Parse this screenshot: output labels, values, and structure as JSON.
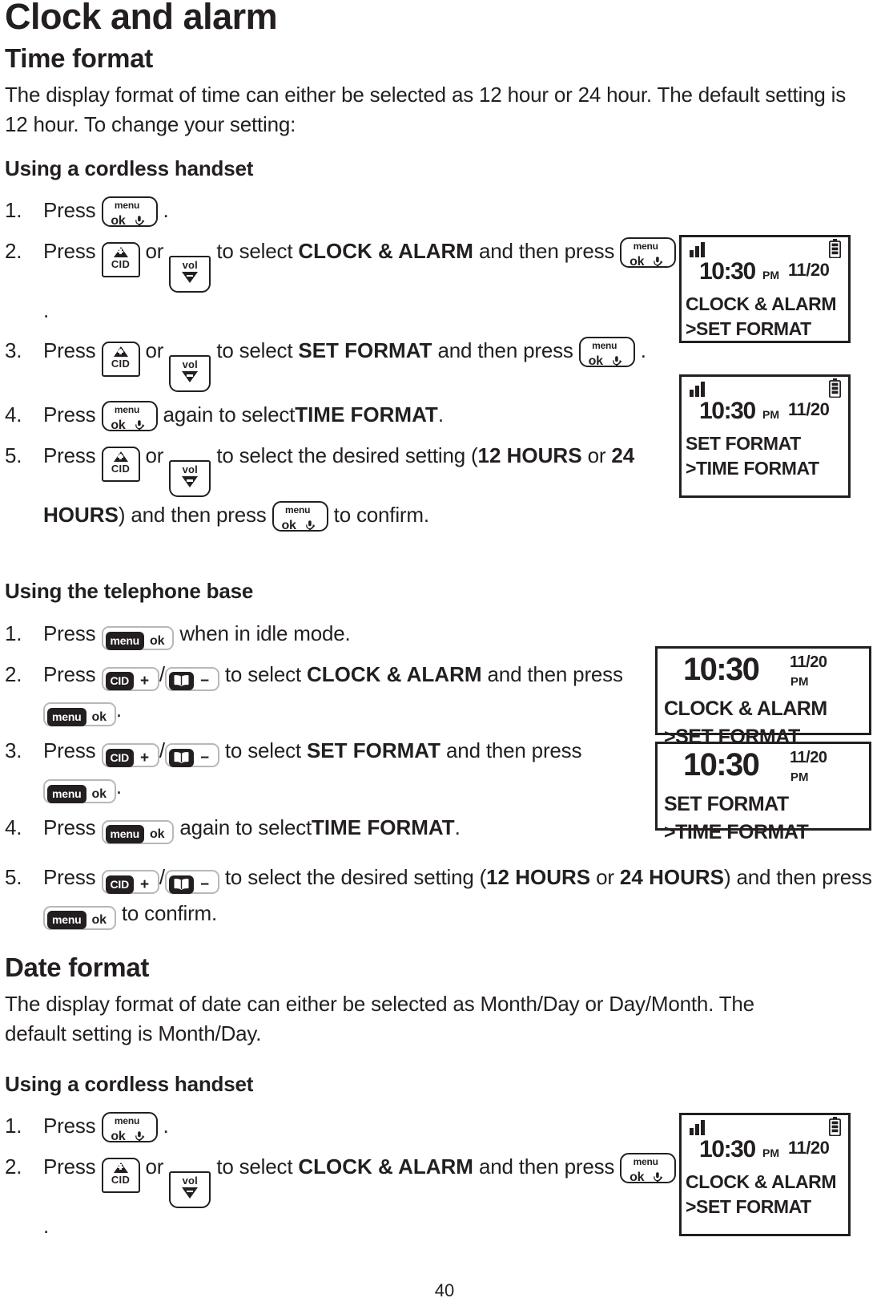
{
  "page": {
    "title": "Clock and alarm",
    "page_number": "40"
  },
  "sections": [
    {
      "heading": "Time format",
      "intro": "The display format of time can either be selected as 12 hour or 24 hour. The default setting is 12 hour. To change your setting:",
      "sub_handset": "Using a cordless handset",
      "sub_base": "Using the telephone base"
    },
    {
      "heading": "Date format",
      "intro": "The display format of date can either be selected as Month/Day or Day/Month. The default setting is Month/Day.",
      "sub_handset": "Using a cordless handset"
    }
  ],
  "handset_steps_time": {
    "s1": {
      "num": "1.",
      "a": "Press",
      "b": "."
    },
    "s2": {
      "num": "2.",
      "a": "Press",
      "or": "or",
      "b": "to select",
      "target": "CLOCK & ALARM",
      "c": "and then press",
      "d": "."
    },
    "s3": {
      "num": "3.",
      "a": "Press",
      "or": "or",
      "b": "to select",
      "target": "SET FORMAT",
      "c": "and then press",
      "d": "."
    },
    "s4": {
      "num": "4.",
      "a": "Press",
      "b": "again to select",
      "target": "TIME FORMAT",
      "c": "."
    },
    "s5": {
      "num": "5.",
      "a": "Press",
      "or": "or",
      "b": "to select the desired setting (",
      "opt1": "12 HOURS",
      "mid": "or",
      "opt2": "24 HOURS",
      "c": ") and then press",
      "d": "to confirm."
    }
  },
  "base_steps_time": {
    "s1": {
      "num": "1.",
      "a": "Press",
      "b": "when in idle mode."
    },
    "s2": {
      "num": "2.",
      "a": "Press",
      "sep": "/",
      "b": "to select",
      "target": "CLOCK & ALARM",
      "c": "and then press",
      "d": "."
    },
    "s3": {
      "num": "3.",
      "a": "Press",
      "sep": "/",
      "b": "to select",
      "target": "SET FORMAT",
      "c": "and then press",
      "d": "."
    },
    "s4": {
      "num": "4.",
      "a": "Press",
      "b": "again to select",
      "target": "TIME FORMAT",
      "c": "."
    },
    "s5": {
      "num": "5.",
      "a": "Press",
      "sep": "/",
      "b": "to select the desired setting (",
      "opt1": "12 HOURS",
      "mid": "or",
      "opt2": "24 HOURS",
      "c": ") and then press",
      "d": "to confirm."
    }
  },
  "handset_steps_date": {
    "s1": {
      "num": "1.",
      "a": "Press",
      "b": "."
    },
    "s2": {
      "num": "2.",
      "a": "Press",
      "or": "or",
      "b": "to select",
      "target": "CLOCK & ALARM",
      "c": "and then press",
      "d": "."
    }
  },
  "keys": {
    "handset_menuok": {
      "menu": "menu",
      "ok": "ok",
      "icon": "mute-mic-icon"
    },
    "handset_cid": {
      "label": "CID",
      "icon": "triangle-up-plus-icon"
    },
    "handset_vol": {
      "label": "vol",
      "icon": "triangle-down-minus-icon"
    },
    "base_menuok": {
      "pill": "menu",
      "ok": "ok"
    },
    "base_cid": {
      "pill": "CID",
      "sign": "+"
    },
    "base_book": {
      "icon": "phonebook-icon",
      "sign": "−"
    }
  },
  "displays": {
    "handset_1": {
      "name": "handset-lcd-clock-alarm",
      "signal": "signal-bars-icon",
      "battery": "battery-full-icon",
      "time": "10:30",
      "meridiem": "PM",
      "date": "11/20",
      "line1": "CLOCK & ALARM",
      "line2": ">SET FORMAT"
    },
    "handset_2": {
      "name": "handset-lcd-set-format",
      "signal": "signal-bars-icon",
      "battery": "battery-full-icon",
      "time": "10:30",
      "meridiem": "PM",
      "date": "11/20",
      "line1": "SET FORMAT",
      "line2": ">TIME FORMAT"
    },
    "base_1": {
      "name": "base-lcd-clock-alarm",
      "time": "10:30",
      "meridiem": "PM",
      "date": "11/20",
      "line1": "CLOCK & ALARM",
      "line2": ">SET FORMAT"
    },
    "base_2": {
      "name": "base-lcd-set-format",
      "time": "10:30",
      "meridiem": "PM",
      "date": "11/20",
      "line1": "SET FORMAT",
      "line2": ">TIME FORMAT"
    },
    "handset_3": {
      "name": "handset-lcd-clock-alarm-date",
      "signal": "signal-bars-icon",
      "battery": "battery-full-icon",
      "time": "10:30",
      "meridiem": "PM",
      "date": "11/20",
      "line1": "CLOCK & ALARM",
      "line2": ">SET FORMAT"
    }
  },
  "colors": {
    "ink": "#231f20",
    "key_border": "#b8b8b8"
  }
}
